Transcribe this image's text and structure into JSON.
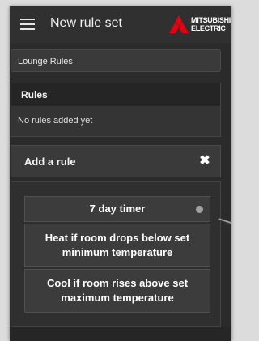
{
  "header": {
    "title": "New rule set",
    "brand_line1": "MITSUBISHI",
    "brand_line2": "ELECTRIC",
    "icon": "hamburger-menu-icon",
    "brand_logo_icon": "mitsubishi-diamonds-icon",
    "brand_color": "#e60012"
  },
  "ruleset": {
    "name_value": "Lounge Rules"
  },
  "rules_section": {
    "title": "Rules",
    "empty_text": "No rules added yet"
  },
  "add_rule": {
    "title": "Add a rule",
    "close_icon": "close-icon",
    "options": [
      {
        "label": "7 day timer"
      },
      {
        "label": "Heat if room drops below set minimum temperature"
      },
      {
        "label": "Cool if room rises above set maximum temperature"
      }
    ]
  }
}
